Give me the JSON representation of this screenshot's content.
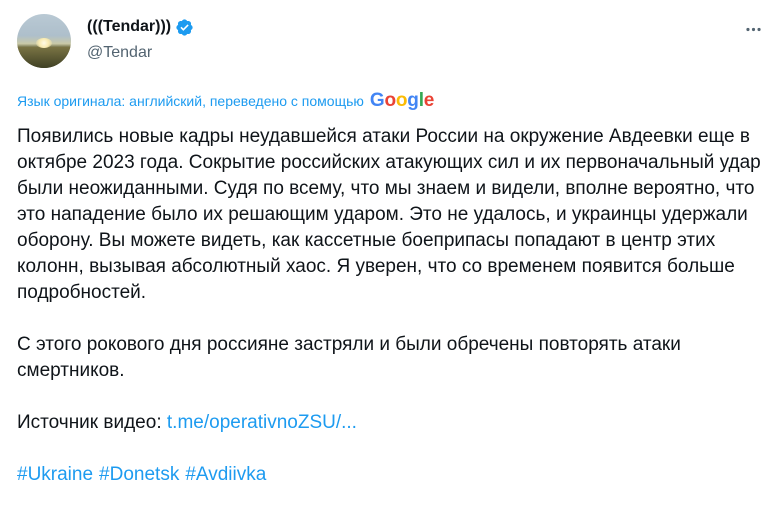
{
  "author": {
    "display_name": "(((Tendar)))",
    "handle": "@Tendar",
    "verified": true
  },
  "translation": {
    "notice": "Язык оригинала: английский, переведено с помощью",
    "provider": "Google"
  },
  "tweet": {
    "paragraphs": [
      "Появились новые кадры неудавшейся атаки России на окружение Авдеевки еще в октябре 2023 года. Сокрытие российских атакующих сил и их первоначальный удар были неожиданными. Судя по всему, что мы знаем и видели, вполне вероятно, что это нападение было их решающим ударом. Это не удалось, и украинцы удержали оборону. Вы можете видеть, как кассетные боеприпасы попадают в центр этих колонн, вызывая абсолютный хаос. Я уверен, что со временем появится больше подробностей.",
      "С этого рокового дня россияне застряли и были обречены повторять атаки смертников."
    ],
    "source_label": "Источник видео: ",
    "source_link": "t.me/operativnoZSU/...",
    "hashtags": [
      "#Ukraine",
      "#Donetsk",
      "#Avdiivka"
    ]
  },
  "colors": {
    "accent": "#1d9bf0",
    "text": "#0f1419",
    "secondary": "#536471"
  },
  "icons": {
    "verified": "verified-badge-icon",
    "more": "more-horizontal-icon"
  }
}
